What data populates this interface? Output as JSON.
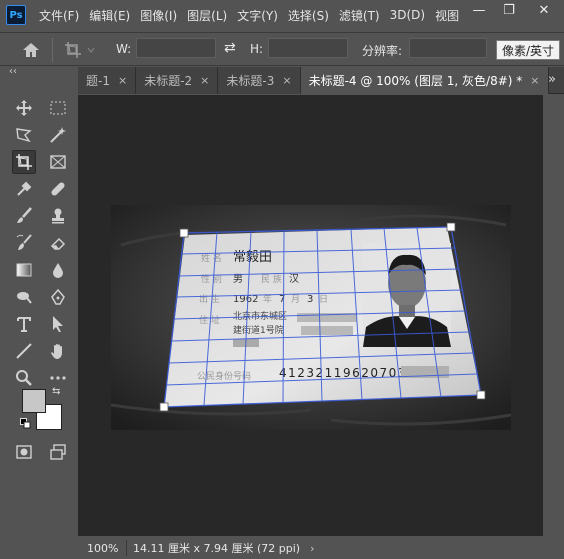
{
  "app": {
    "logo_text": "Ps"
  },
  "menu": [
    "文件(F)",
    "编辑(E)",
    "图像(I)",
    "图层(L)",
    "文字(Y)",
    "选择(S)",
    "滤镜(T)",
    "3D(D)",
    "视图"
  ],
  "window_controls": {
    "minimize": "—",
    "restore": "❐",
    "close": "✕"
  },
  "options": {
    "w_label": "W:",
    "w_value": "",
    "h_label": "H:",
    "h_value": "",
    "resolution_label": "分辨率:",
    "resolution_value": "",
    "unit_tooltip": "像素/英寸"
  },
  "tabs": [
    {
      "label": "题-1",
      "close": "×"
    },
    {
      "label": "未标题-2",
      "close": "×"
    },
    {
      "label": "未标题-3",
      "close": "×"
    },
    {
      "label": "未标题-4 @ 100% (图层 1, 灰色/8#) *",
      "close": "×",
      "active": true
    }
  ],
  "tab_overflow": "»",
  "collapse_glyph": "‹‹",
  "colors": {
    "foreground": "#c7c7c7",
    "background": "#ffffff",
    "accent": "#31a8ff"
  },
  "id_card": {
    "name": "常毅田",
    "sex": "男",
    "ethnicity": "汉",
    "birth_year": "1962",
    "birth_month": "7",
    "birth_day": "3",
    "address_line1": "北京市东城区",
    "address_line2": "建街道1号院",
    "id_number": "412321196207031",
    "label_name": "姓 名",
    "label_sex": "性 别",
    "label_ethnicity": "民 族",
    "label_birth": "出 生",
    "label_year": "年",
    "label_month": "月",
    "label_day": "日",
    "label_address": "住 址",
    "label_id": "公民身份号码"
  },
  "status": {
    "zoom": "100%",
    "doc_info": "14.11 厘米 x 7.94 厘米 (72 ppi)",
    "arrow": "›"
  }
}
